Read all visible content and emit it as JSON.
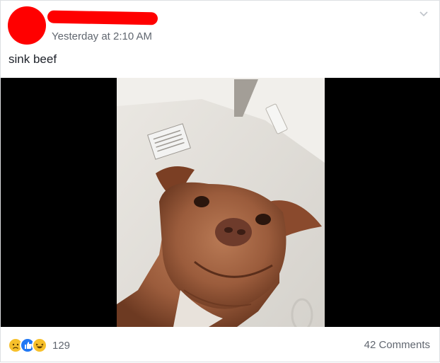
{
  "post": {
    "author_redacted": true,
    "timestamp": "Yesterday at 2:10 AM",
    "text": "sink beef"
  },
  "footer": {
    "reaction_icons": [
      "sad-icon",
      "like-icon",
      "haha-icon"
    ],
    "reaction_count": "129",
    "comments_label": "42 Comments"
  },
  "colors": {
    "redaction": "#ff0000",
    "like_blue": "#2078f4",
    "emoji_yellow": "#f7c02b",
    "meta_text": "#616770"
  }
}
